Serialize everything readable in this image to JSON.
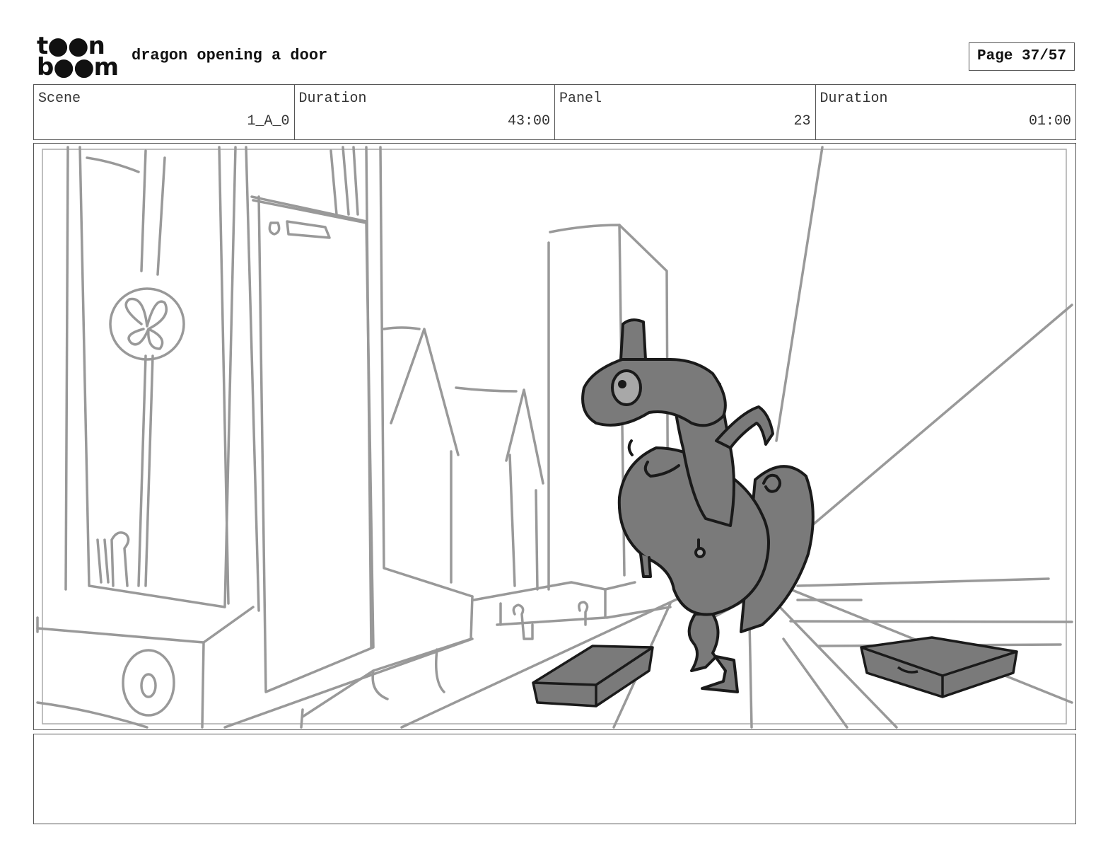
{
  "header": {
    "logo_top": "t●●n",
    "logo_bottom": "b●●m",
    "title": "dragon opening a door",
    "page_indicator": "Page 37/57"
  },
  "info": {
    "scene_label": "Scene",
    "scene_value": "1_A_0",
    "duration_label": "Duration",
    "duration_value": "43:00",
    "panel_label": "Panel",
    "panel_value": "23",
    "panel_duration_label": "Duration",
    "panel_duration_value": "01:00"
  },
  "colors": {
    "sketch_line": "#999999",
    "character_fill": "#808080",
    "character_line": "#1a1a1a"
  }
}
